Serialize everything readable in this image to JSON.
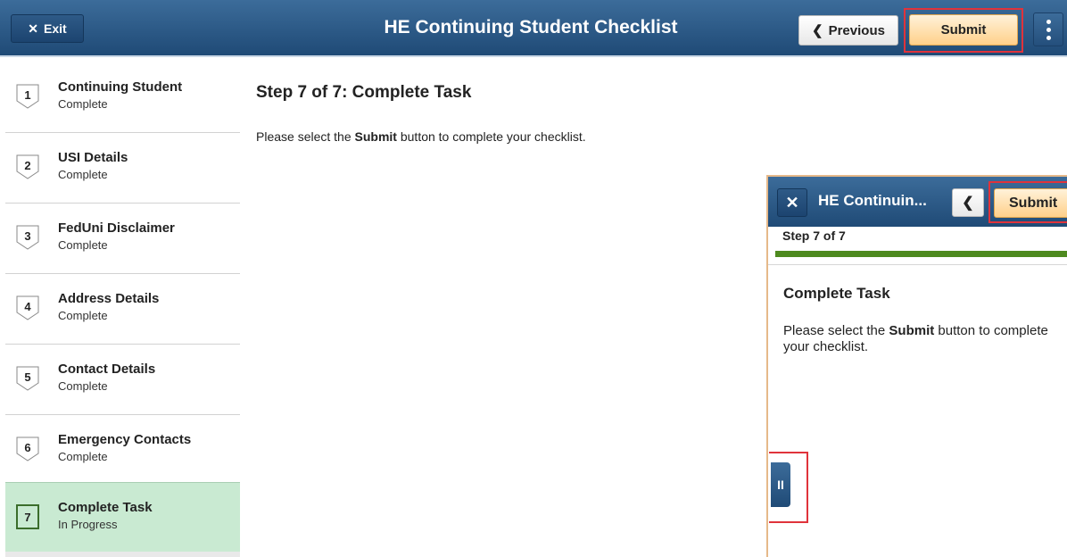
{
  "header": {
    "exit_label": "Exit",
    "title": "HE Continuing Student Checklist",
    "previous_label": "Previous",
    "submit_label": "Submit"
  },
  "sidebar": {
    "steps": [
      {
        "number": "1",
        "label": "Continuing Student",
        "status": "Complete"
      },
      {
        "number": "2",
        "label": "USI Details",
        "status": "Complete"
      },
      {
        "number": "3",
        "label": "FedUni Disclaimer",
        "status": "Complete"
      },
      {
        "number": "4",
        "label": "Address Details",
        "status": "Complete"
      },
      {
        "number": "5",
        "label": "Contact Details",
        "status": "Complete"
      },
      {
        "number": "6",
        "label": "Emergency Contacts",
        "status": "Complete"
      },
      {
        "number": "7",
        "label": "Complete Task",
        "status": "In Progress"
      }
    ]
  },
  "main": {
    "heading": "Step 7 of 7: Complete Task",
    "instruction_pre": "Please select the ",
    "instruction_bold": "Submit",
    "instruction_post": " button to complete your checklist."
  },
  "mobile": {
    "title": "HE Continuin...",
    "submit_label": "Submit",
    "step_text": "Step 7 of 7",
    "progress_fraction": 1.0,
    "heading": "Complete Task",
    "instruction_pre": "Please select the ",
    "instruction_bold": "Submit",
    "instruction_post": " button to complete your checklist.",
    "handle_glyph": "II"
  },
  "colors": {
    "header_blue": "#2a5888",
    "submit_orange": "#ffd08a",
    "active_step_green": "#c9ead2",
    "progress_green": "#4e8a1f",
    "highlight_red": "#e0333b"
  }
}
